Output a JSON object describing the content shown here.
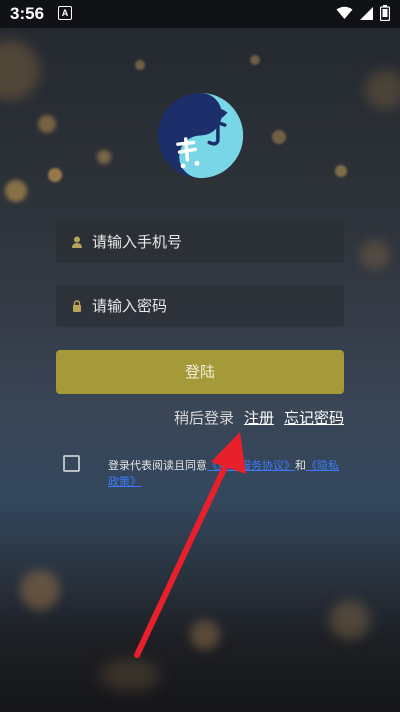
{
  "status_bar": {
    "time": "3:56",
    "notification_glyph": "A"
  },
  "logo": {
    "alt": "yin-yang-logo"
  },
  "form": {
    "phone_placeholder": "请输入手机号",
    "password_placeholder": "请输入密码",
    "login_label": "登陆"
  },
  "links": {
    "later": "稍后登录",
    "register": "注册",
    "forgot": "忘记密码"
  },
  "agreement": {
    "prefix": "登录代表阅读且同意",
    "service": "《用户服务协议》",
    "and": "和",
    "privacy": "《隐私政策》"
  },
  "colors": {
    "login_button": "#a49a3a",
    "link_blue": "#3d7bff",
    "arrow": "#e8202b"
  }
}
